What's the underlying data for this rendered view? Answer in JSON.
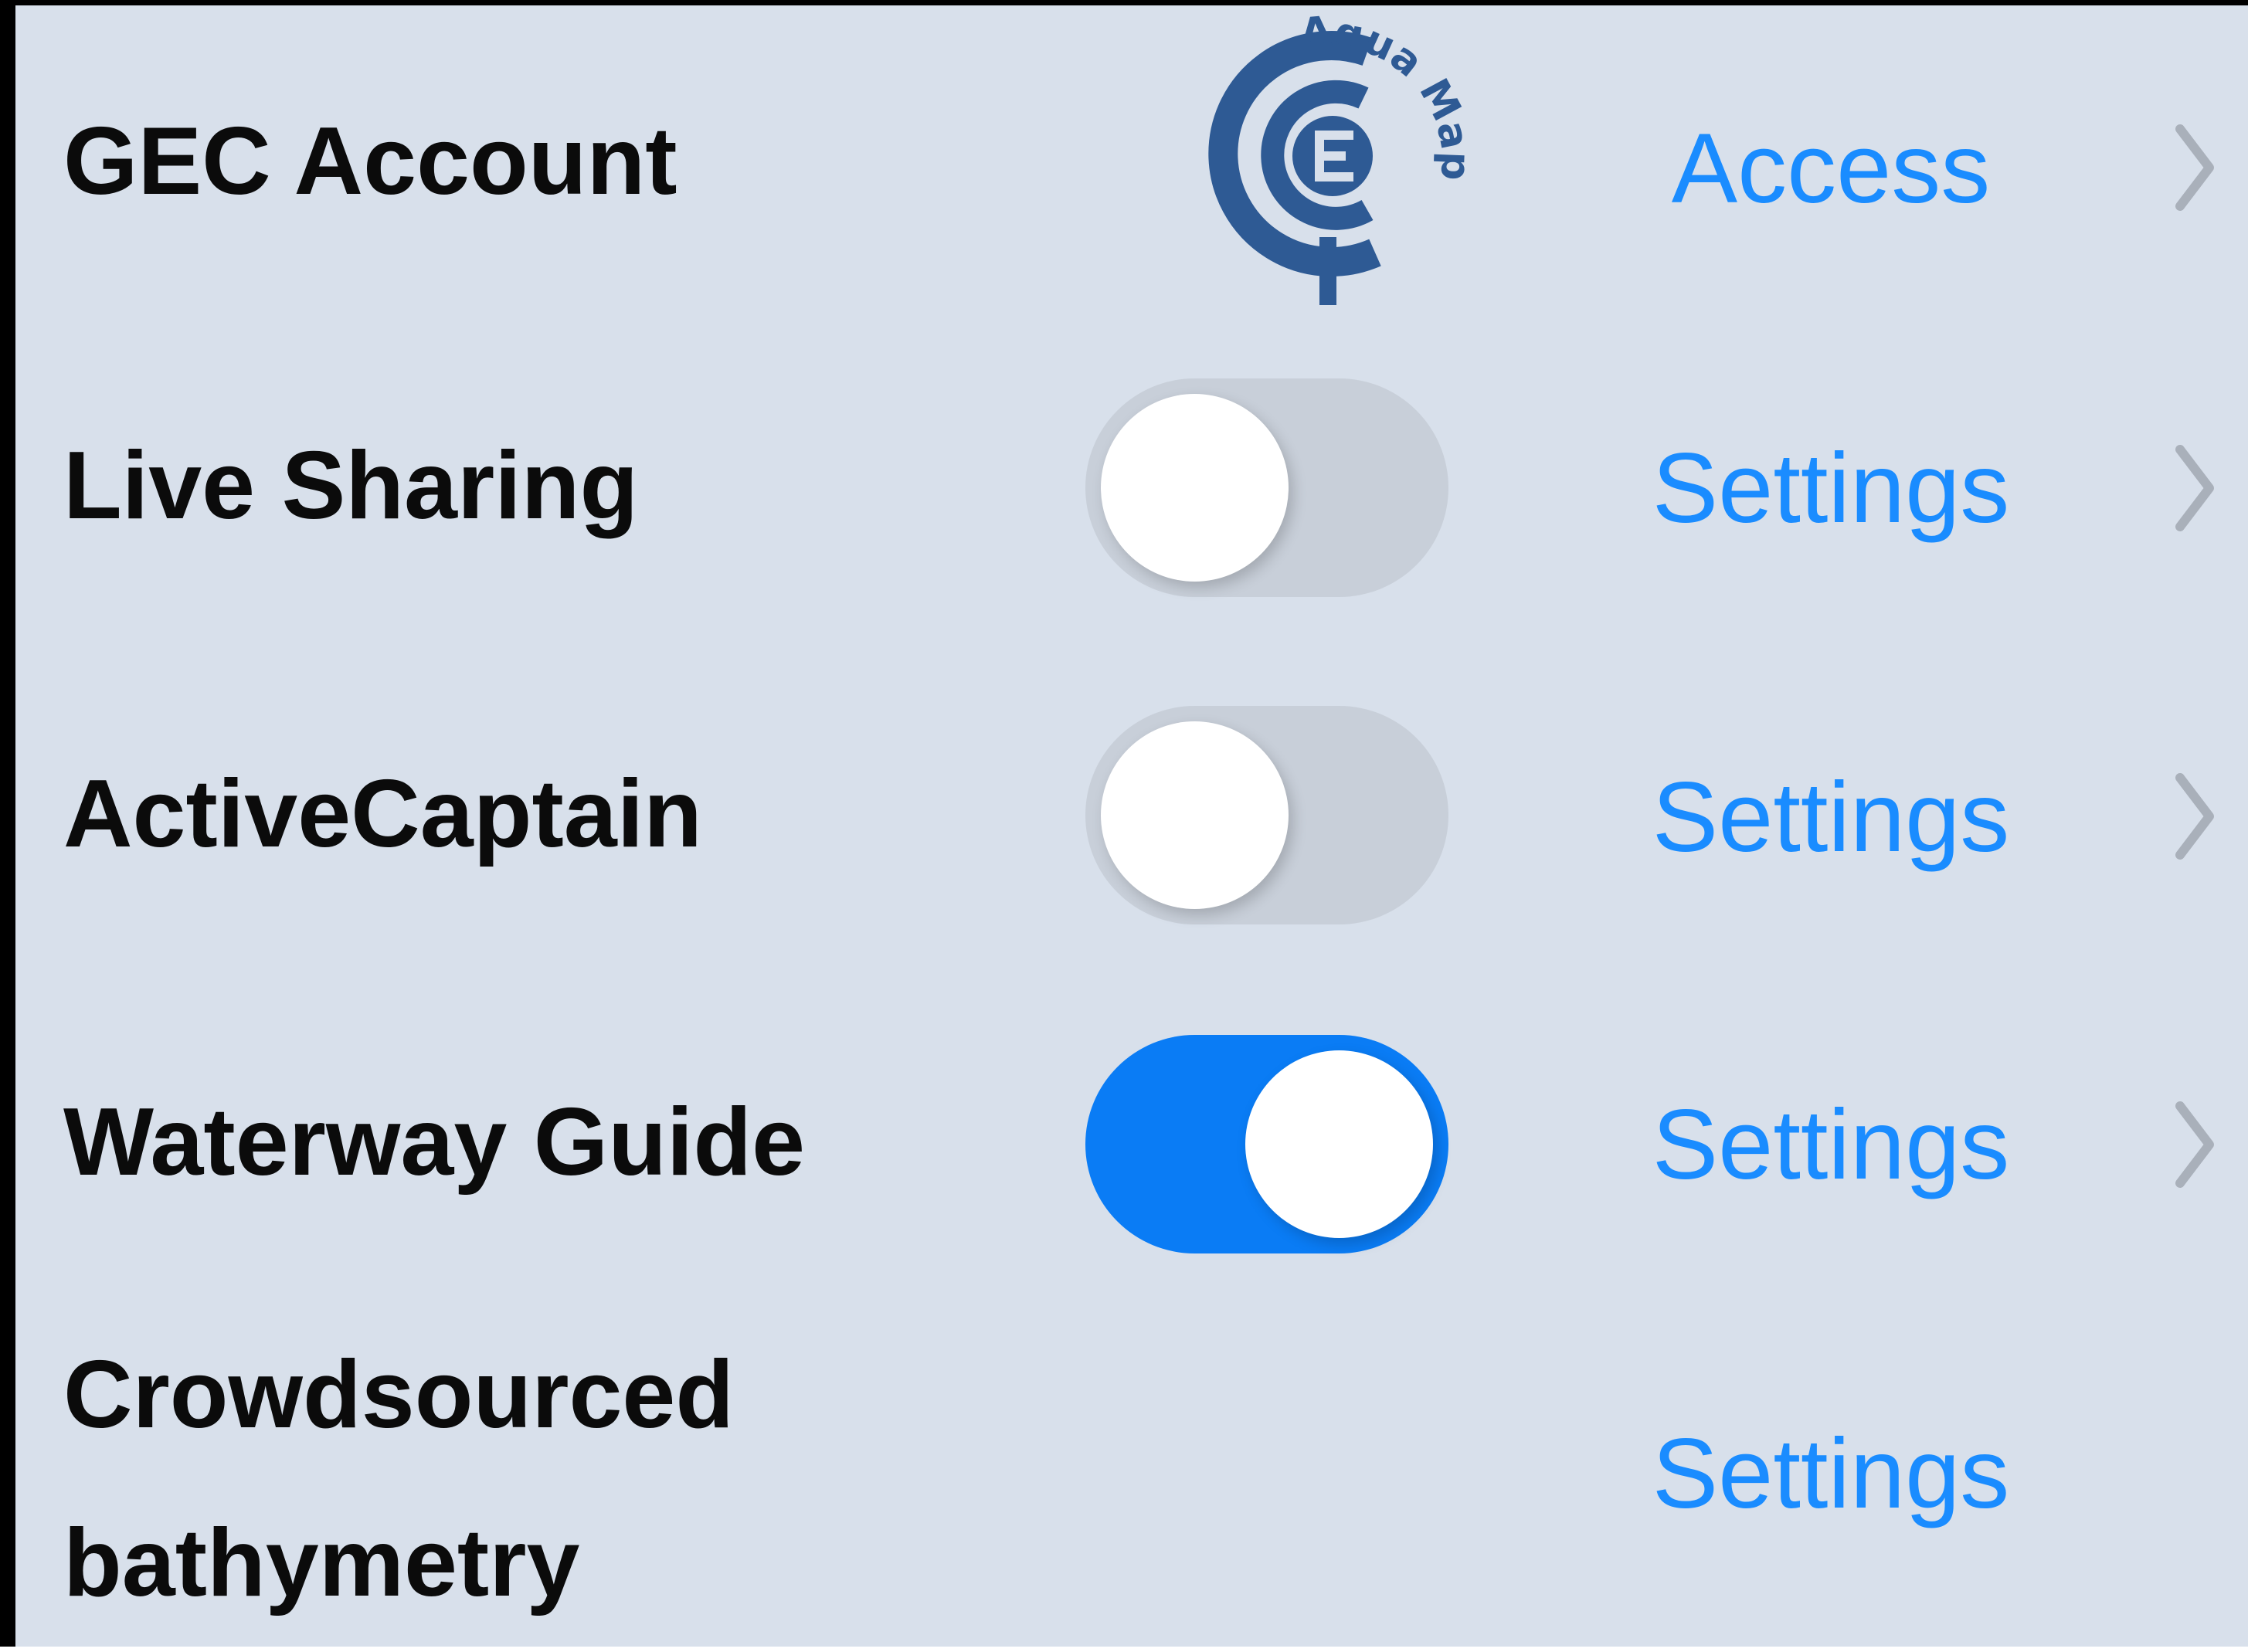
{
  "rows": [
    {
      "label": "GEC Account",
      "action": "Access",
      "toggle": null,
      "logo": "aqua-map-logo",
      "logo_text": "Aqua Map"
    },
    {
      "label": "Live Sharing",
      "action": "Settings",
      "toggle": false
    },
    {
      "label": "ActiveCaptain",
      "action": "Settings",
      "toggle": false
    },
    {
      "label": "Waterway Guide",
      "action": "Settings",
      "toggle": true
    },
    {
      "label": "Crowdsourced bathymetry",
      "action": "Settings",
      "toggle": null
    }
  ],
  "colors": {
    "background": "#d8e0eb",
    "accent": "#1a8cff",
    "toggle_on": "#0a7cf5",
    "toggle_off": "#c8cfd9",
    "logo": "#2e5a94",
    "chevron": "#a9b0ba"
  },
  "icons": {
    "chevron": "chevron-right-icon"
  }
}
